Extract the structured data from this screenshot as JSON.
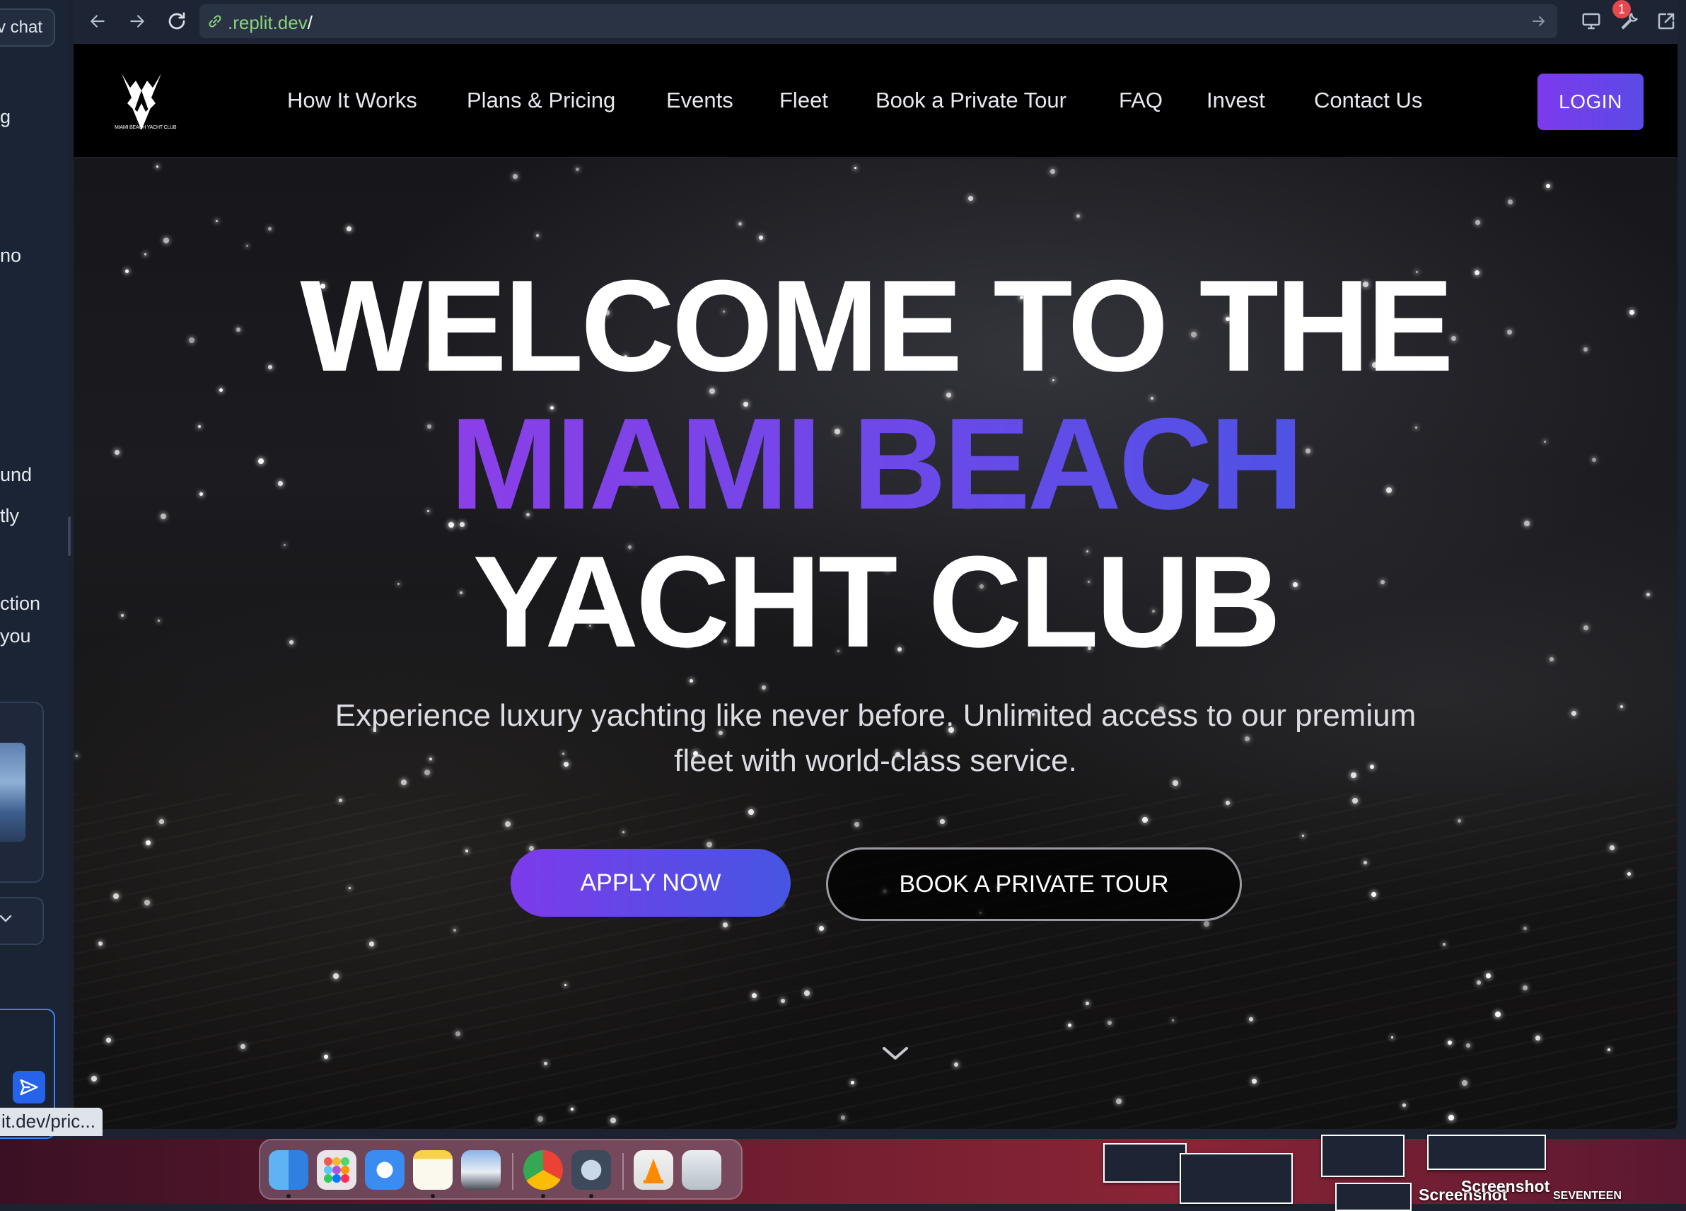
{
  "chat_panel": {
    "new_chat_label": "v chat",
    "fragments": [
      "g",
      "no",
      "und",
      "tly",
      "ction",
      "you"
    ],
    "send_icon": "send-icon",
    "select_icon": "chevron-down-icon"
  },
  "browser": {
    "url": ".replit.dev",
    "url_suffix": "/",
    "notification_count": "1",
    "status_url": "it.dev/pric..."
  },
  "site": {
    "logo_caption": "MIAMI BEACH YACHT CLUB",
    "nav": [
      "How It Works",
      "Plans & Pricing",
      "Events",
      "Fleet",
      "Book a Private Tour",
      "FAQ",
      "Invest",
      "Contact Us"
    ],
    "login_label": "LOGIN",
    "hero": {
      "line1": "WELCOME TO THE",
      "line2": "MIAMI BEACH",
      "line3": "YACHT CLUB",
      "subtitle": "Experience luxury yachting like never before. Unlimited access to our premium fleet with world-class service.",
      "apply_label": "APPLY NOW",
      "tour_label": "BOOK A PRIVATE TOUR"
    },
    "colors": {
      "accent_start": "#7c3aed",
      "accent_end": "#4f52e6",
      "nav_bg": "#000000"
    }
  },
  "desktop": {
    "labels": [
      "Screenshot",
      "Screenshot",
      "SEVENTEEN"
    ]
  }
}
